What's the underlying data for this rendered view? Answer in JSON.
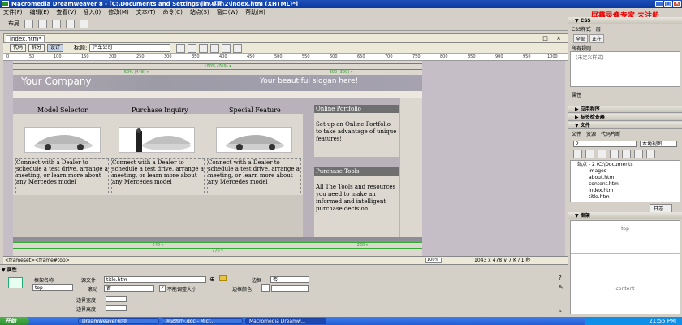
{
  "window": {
    "title": "Macromedia Dreamweaver 8 - [C:\\Documents and Settings\\jin\\桌面\\2\\index.htm (XHTML)*]"
  },
  "menu": [
    "文件(F)",
    "编辑(E)",
    "查看(V)",
    "插入(I)",
    "修改(M)",
    "文本(T)",
    "命令(C)",
    "站点(S)",
    "窗口(W)",
    "帮助(H)"
  ],
  "watermark": "屏幕录像专家 未注册",
  "insertbar": {
    "category": "布局"
  },
  "document": {
    "tab": "index.htm*",
    "views": {
      "code": "代码",
      "split": "拆分",
      "design": "设计"
    },
    "title_label": "标题:",
    "title_value": "汽车公司"
  },
  "ruler": [
    "0",
    "50",
    "100",
    "150",
    "200",
    "250",
    "300",
    "350",
    "400",
    "450",
    "500",
    "550",
    "600",
    "650",
    "700",
    "750",
    "800",
    "850",
    "900",
    "950",
    "1000"
  ],
  "page": {
    "width_top": "100% (769) ▾",
    "col1_width": "50% (448) ▾",
    "col2_width": "300 (309) ▾",
    "company": "Your Company",
    "slogan": "Your beautiful slogan here!",
    "features": [
      {
        "title": "Model Selector",
        "text": "Connect with a Dealer to schedule a test drive, arrange a meeting, or learn more about any Mercedes model"
      },
      {
        "title": "Purchase Inquiry",
        "text": "Connect with a Dealer to schedule a test drive, arrange a meeting, or learn more about any Mercedes model"
      },
      {
        "title": "Special Feature",
        "text": "Connect with a Dealer to schedule a test drive, arrange a meeting, or learn more about any Mercedes model"
      }
    ],
    "side": [
      {
        "title": "Online Portfolio",
        "text": "Set up an Online Portfolio to take advantage of unique features!"
      },
      {
        "title": "Purchase Tools",
        "text": "All The Tools and resources you need to make an informed and intelligent purchase decision."
      }
    ],
    "width_bottom_left": "540 ▾",
    "width_bottom_right": "220 ▾",
    "width_bottom": "770 ▾"
  },
  "status": {
    "tags": "<frameset><frame#top>",
    "zoom": "100%",
    "size": "1043 x 478 ∨ 7 K / 1 秒"
  },
  "properties": {
    "header": "▼ 属性",
    "frame_name_label": "框架名称",
    "frame_name_value": "top",
    "source_label": "源文件",
    "source_value": "title.htm",
    "border_label": "边框",
    "border_value": "否",
    "scroll_label": "滚动",
    "scroll_value": "否",
    "noresize_label": "不能调整大小",
    "border_color_label": "边框颜色",
    "margin_w_label": "边界宽度",
    "margin_h_label": "边界高度"
  },
  "panels": {
    "css": {
      "header": "▼ CSS",
      "tabs": [
        "CSS样式",
        "层"
      ],
      "buttons": [
        "全部",
        "正在"
      ],
      "rules_label": "所有规则",
      "rules_value": "(未定义样式)"
    },
    "attr_label": "属性",
    "app": "▶ 应用程序",
    "tag": "▶ 标签检查器",
    "files": {
      "header": "▼ 文件",
      "tabs": [
        "文件",
        "资源",
        "代码片断"
      ],
      "site": "2",
      "view": "本地视图",
      "items": [
        "站点 - 2 (C:\\Documents",
        "images",
        "about.htm",
        "content.htm",
        "index.htm",
        "title.htm"
      ],
      "log_button": "日志..."
    },
    "frames": {
      "header": "▼ 框架",
      "top": "top",
      "content": "content"
    }
  },
  "taskbar": {
    "start": "开始",
    "items": [
      "DreamWeaver视频",
      "网站制作.doc - Micr...",
      "Macromedia Dreamw..."
    ],
    "clock": "21:55 PM"
  },
  "colors": {
    "accent": "#245dd7",
    "header_bar": "#9c9ba6",
    "feature_bar": "#b8b0b8"
  }
}
